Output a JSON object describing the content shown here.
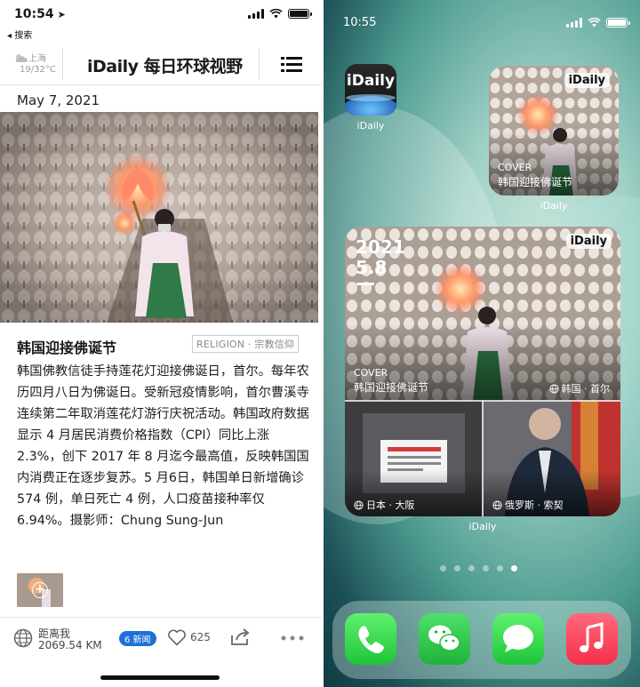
{
  "left": {
    "status": {
      "time": "10:54",
      "back_label": "◂ 搜索"
    },
    "header": {
      "city": "上海",
      "temp": "19/32°C",
      "title": "iDaily 每日环球视野"
    },
    "date": "May 7, 2021",
    "article": {
      "title": "韩国迎接佛诞节",
      "tag": "RELIGION · 宗教信仰",
      "body": "韩国佛教信徒手持莲花灯迎接佛诞日，首尔。每年农历四月八日为佛诞日。受新冠疫情影响，首尔曹溪寺连续第二年取消莲花灯游行庆祝活动。韩国政府数据显示 4 月居民消费价格指数（CPI）同比上涨 2.3%，创下 2017 年 8 月迄今最高值，反映韩国国内消费正在逐步复苏。5 月6日，韩国单日新增确诊 574 例，单日死亡 4 例，人口疫苗接种率仅 6.94%。摄影师：Chung Sung-Jun"
    },
    "toolbar": {
      "distance_label": "距离我",
      "distance_value": "2069.54 KM",
      "news_badge": "6 新闻",
      "likes": "625"
    }
  },
  "right": {
    "status": {
      "time": "10:55"
    },
    "app": {
      "name": "iDaily",
      "label": "iDaily"
    },
    "widget_small": {
      "badge": "iDaily",
      "cover_label": "COVER",
      "cover_title": "韩国迎接佛诞节",
      "label": "iDaily"
    },
    "widget_large": {
      "badge": "iDaily",
      "date_year": "2021",
      "date_md": "5.8",
      "cover_label": "COVER",
      "cover_title": "韩国迎接佛诞节",
      "cover_location": "韩国 · 首尔",
      "item1_location": "日本 · 大阪",
      "item2_location": "俄罗斯 · 索契",
      "label": "iDaily"
    },
    "page_dots": {
      "count": 6,
      "active": 6
    },
    "dock": [
      "phone-icon",
      "wechat-icon",
      "messages-icon",
      "music-icon"
    ]
  }
}
